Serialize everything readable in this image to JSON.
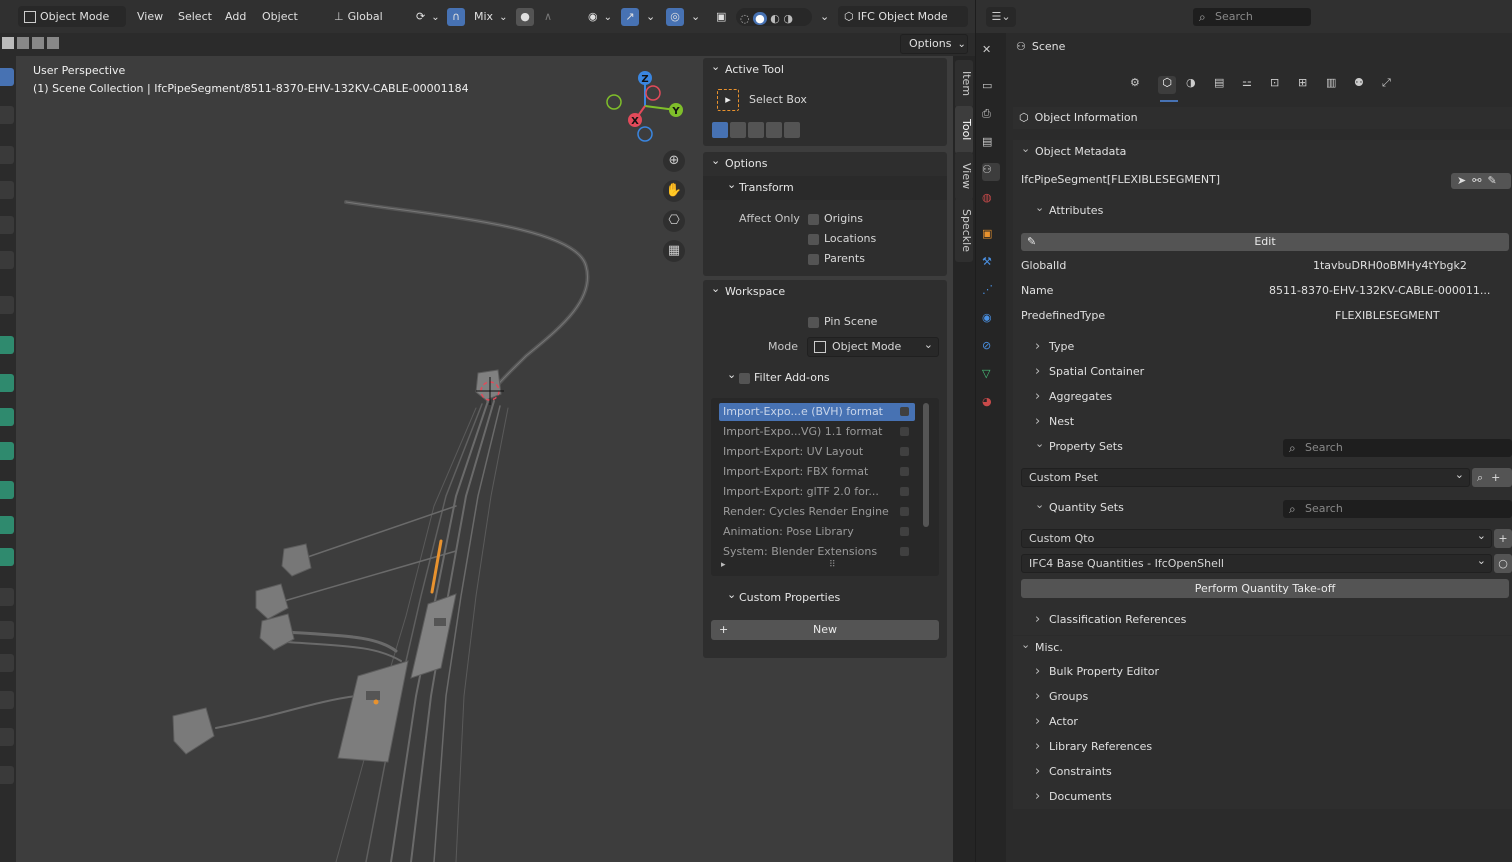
{
  "header": {
    "mode": "Object Mode",
    "menus": [
      "View",
      "Select",
      "Add",
      "Object"
    ],
    "orientation": "Global",
    "snap_mix": "Mix",
    "ifc_mode": "IFC Object Mode",
    "options": "Options"
  },
  "viewport": {
    "perspective": "User Perspective",
    "collection": "(1) Scene Collection | IfcPipeSegment/8511-8370-EHV-132KV-CABLE-00001184",
    "gizmo": {
      "z": "Z",
      "y": "Y",
      "x": "X"
    }
  },
  "ntabs": [
    "Item",
    "Tool",
    "View",
    "Speckle"
  ],
  "tool_panel": {
    "active_tool": "Active Tool",
    "select_box": "Select Box",
    "options": "Options",
    "transform": "Transform",
    "affect_only": "Affect Only",
    "origins": "Origins",
    "locations": "Locations",
    "parents": "Parents",
    "workspace": "Workspace",
    "pin_scene": "Pin Scene",
    "mode_label": "Mode",
    "mode_value": "Object Mode",
    "filter_addons": "Filter Add-ons",
    "addons": [
      "Import-Expo...e (BVH) format",
      "Import-Expo...VG) 1.1 format",
      "Import-Export: UV Layout",
      "Import-Export: FBX format",
      "Import-Export: glTF 2.0 for...",
      "Render: Cycles Render Engine",
      "Animation: Pose Library",
      "System: Blender Extensions"
    ],
    "custom_properties": "Custom Properties",
    "new": "New"
  },
  "properties": {
    "search_placeholder": "Search",
    "scene": "Scene",
    "object_information": "Object Information",
    "object_metadata": "Object Metadata",
    "entity": "IfcPipeSegment[FLEXIBLESEGMENT]",
    "attributes": "Attributes",
    "edit": "Edit",
    "attrs": [
      {
        "key": "GlobalId",
        "value": "1tavbuDRH0oBMHy4tYbgk2"
      },
      {
        "key": "Name",
        "value": "8511-8370-EHV-132KV-CABLE-000011..."
      },
      {
        "key": "PredefinedType",
        "value": "FLEXIBLESEGMENT"
      }
    ],
    "type": "Type",
    "spatial_container": "Spatial Container",
    "aggregates": "Aggregates",
    "nest": "Nest",
    "property_sets": "Property Sets",
    "custom_pset": "Custom Pset",
    "quantity_sets": "Quantity Sets",
    "custom_qto": "Custom Qto",
    "base_quantities": "IFC4 Base Quantities - IfcOpenShell",
    "perform_qto": "Perform Quantity Take-off",
    "classification": "Classification References",
    "misc": "Misc.",
    "misc_items": [
      "Bulk Property Editor",
      "Groups",
      "Actor",
      "Library References",
      "Constraints",
      "Documents"
    ]
  },
  "colors": {
    "selection": "#4772b3",
    "accent_orange": "#e8922e",
    "axis_x": "#e24a5a",
    "axis_y": "#7fbf2a",
    "axis_z": "#3a86e0"
  }
}
